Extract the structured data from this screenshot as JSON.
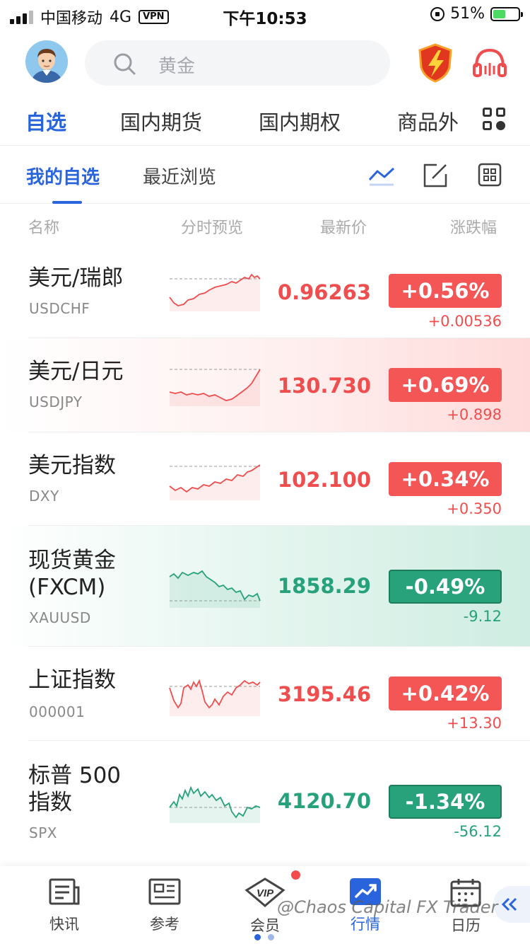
{
  "status_bar": {
    "carrier": "中国移动",
    "network": "4G",
    "vpn": "VPN",
    "time": "下午10:53",
    "battery": "51%",
    "battery_level": 0.51
  },
  "search": {
    "placeholder": "黄金"
  },
  "top_tabs": [
    {
      "label": "自选",
      "active": true
    },
    {
      "label": "国内期货"
    },
    {
      "label": "国内期权"
    },
    {
      "label": "商品外"
    }
  ],
  "sub_tabs": [
    {
      "label": "我的自选",
      "active": true
    },
    {
      "label": "最近浏览"
    }
  ],
  "columns": [
    "名称",
    "分时预览",
    "最新价",
    "涨跌幅"
  ],
  "colors": {
    "up": "#f04e4e",
    "down": "#26a17b",
    "accent": "#2a64dc"
  },
  "rows": [
    {
      "name": "美元/瑞郎",
      "code": "USDCHF",
      "price": "0.96263",
      "pct": "+0.56%",
      "change": "+0.00536",
      "dir": "up"
    },
    {
      "name": "美元/日元",
      "code": "USDJPY",
      "price": "130.730",
      "pct": "+0.69%",
      "change": "+0.898",
      "dir": "up"
    },
    {
      "name": "美元指数",
      "code": "DXY",
      "price": "102.100",
      "pct": "+0.34%",
      "change": "+0.350",
      "dir": "up"
    },
    {
      "name": "现货黄金\n(FXCM)",
      "code": "XAUUSD",
      "price": "1858.29",
      "pct": "-0.49%",
      "change": "-9.12",
      "dir": "down"
    },
    {
      "name": "上证指数",
      "code": "000001",
      "price": "3195.46",
      "pct": "+0.42%",
      "change": "+13.30",
      "dir": "up"
    },
    {
      "name": "标普 500\n指数",
      "code": "SPX",
      "price": "4120.70",
      "pct": "-1.34%",
      "change": "-56.12",
      "dir": "down"
    }
  ],
  "nav": [
    {
      "label": "快讯",
      "icon": "news-icon"
    },
    {
      "label": "参考",
      "icon": "reference-icon"
    },
    {
      "label": "会员",
      "icon": "vip-icon"
    },
    {
      "label": "行情",
      "icon": "chart-icon",
      "active": true
    },
    {
      "label": "日历",
      "icon": "calendar-icon"
    }
  ],
  "watermark": "@Chaos Capital FX Trader"
}
